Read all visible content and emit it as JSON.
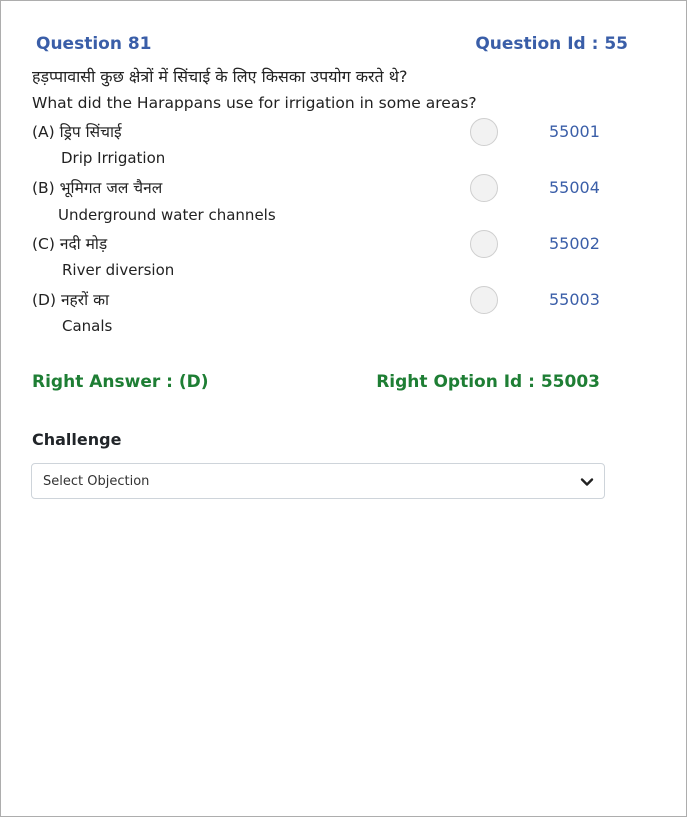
{
  "question": {
    "number_label": "Question 81",
    "id_label": "Question Id : 55",
    "text_hindi": "हड़प्पावासी कुछ क्षेत्रों में सिंचाई के लिए किसका उपयोग करते थे?",
    "text_english": "What did the Harappans use for irrigation in some areas?"
  },
  "options": [
    {
      "label_hindi": "(A) ड्रिप सिंचाई",
      "label_english": "Drip Irrigation",
      "option_id": "55001"
    },
    {
      "label_hindi": "(B) भूमिगत जल चैनल",
      "label_english": "Underground water channels",
      "option_id": "55004"
    },
    {
      "label_hindi": "(C) नदी मोड़",
      "label_english": "River diversion",
      "option_id": "55002"
    },
    {
      "label_hindi": "(D) नहरों का",
      "label_english": "Canals",
      "option_id": "55003"
    }
  ],
  "answer": {
    "right_answer_label": "Right Answer : (D)",
    "right_option_id_label": "Right Option Id : 55003"
  },
  "challenge": {
    "heading": "Challenge",
    "select_value": "Select Objection"
  },
  "colors": {
    "accent_blue": "#3a5ea8",
    "answer_green": "#1e7e34"
  }
}
